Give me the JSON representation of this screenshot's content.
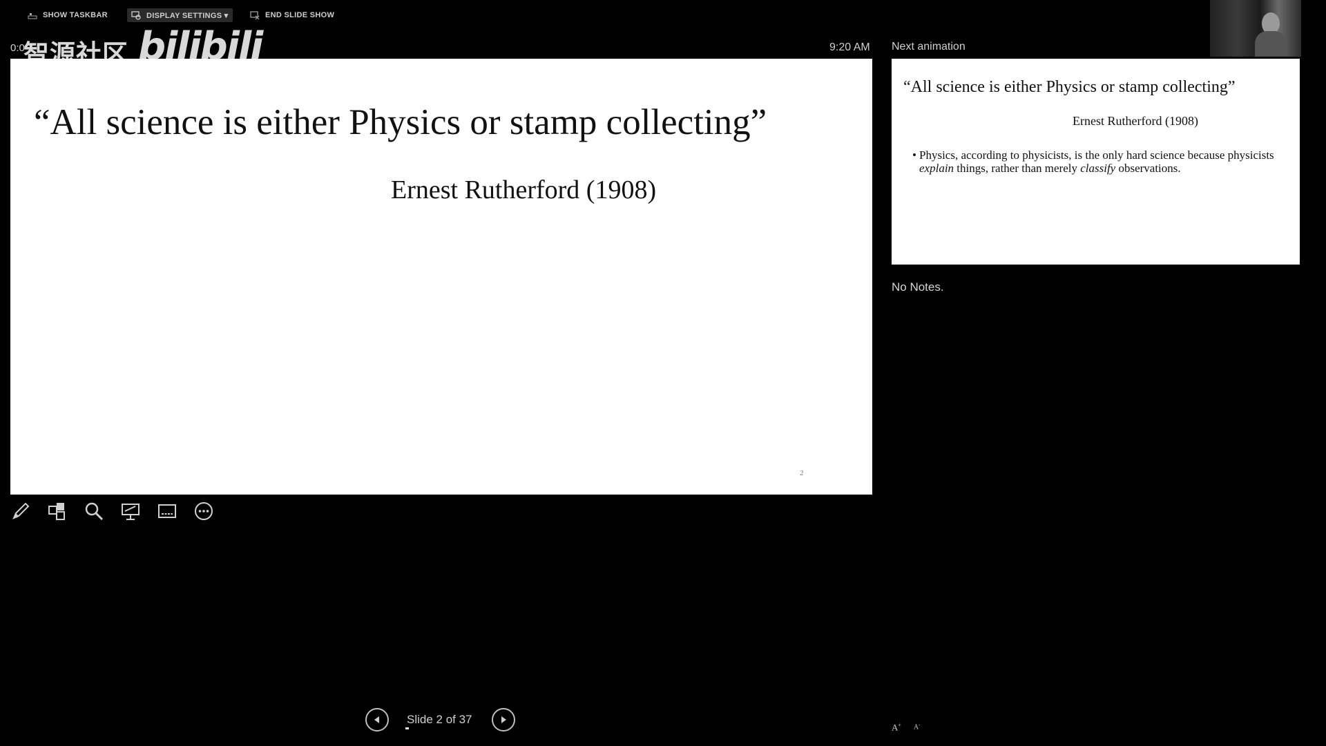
{
  "toolbar": {
    "show_taskbar": "SHOW TASKBAR",
    "display_settings": "DISPLAY SETTINGS ▾",
    "end_slide_show": "END SLIDE SHOW"
  },
  "overlay": {
    "timer": "0:0",
    "watermark_cn": "智源社区",
    "watermark_brand": "bilibili",
    "clock": "9:20 AM"
  },
  "current_slide": {
    "quote": "“All science is either Physics or stamp collecting”",
    "author": "Ernest Rutherford (1908)",
    "page_number": "2"
  },
  "next_panel": {
    "label": "Next animation",
    "quote": "“All science is either Physics or stamp collecting”",
    "author": "Ernest Rutherford (1908)",
    "bullet_part1": "Physics, according to physicists, is the only hard science because physicists ",
    "bullet_em1": "explain",
    "bullet_part2": " things, rather than merely ",
    "bullet_em2": "classify",
    "bullet_part3": " observations."
  },
  "notes": "No Notes.",
  "tools": [
    "pen-icon",
    "slides-grid-icon",
    "zoom-icon",
    "pointer-screen-icon",
    "subtitles-icon",
    "more-icon"
  ],
  "navigation": {
    "slide_counter": "Slide 2 of 37",
    "progress": 0.054
  },
  "font_controls": {
    "increase": "A",
    "decrease": "A"
  }
}
